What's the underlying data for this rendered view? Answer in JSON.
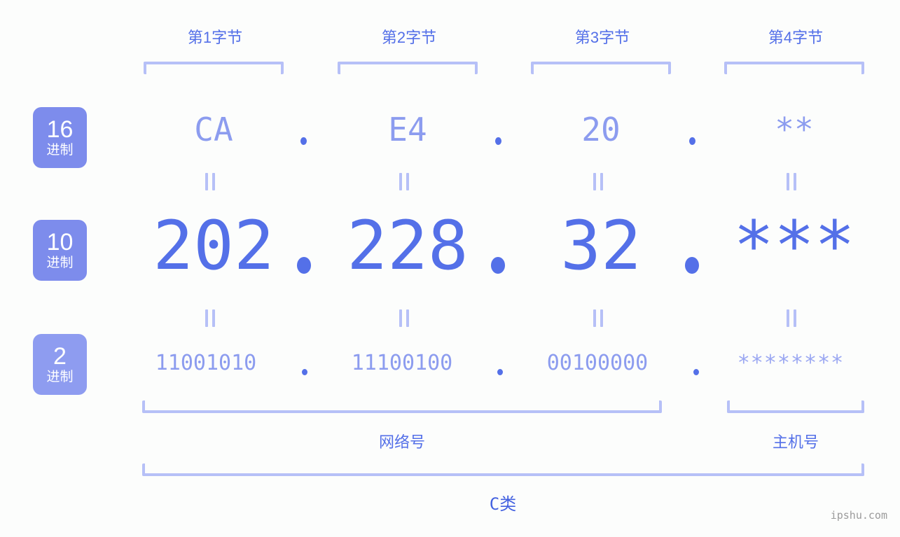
{
  "background_color": "#fcfdfc",
  "palette": {
    "accent_strong": "#5470e8",
    "accent_light": "#8c9cef",
    "bracket": "#b6c0f7",
    "badge": "#7d8cec",
    "badge_light": "#8e9cf0",
    "class_text": "#4361e0",
    "watermark": "#9b9b9b"
  },
  "byte_headers": [
    {
      "label": "第1字节"
    },
    {
      "label": "第2字节"
    },
    {
      "label": "第3字节"
    },
    {
      "label": "第4字节"
    }
  ],
  "rows": [
    {
      "badge_number": "16",
      "badge_sub": "进制",
      "values": [
        "CA",
        "E4",
        "20",
        "**"
      ],
      "separator": "."
    },
    {
      "badge_number": "10",
      "badge_sub": "进制",
      "values": [
        "202",
        "228",
        "32",
        "***"
      ],
      "separator": "."
    },
    {
      "badge_number": "2",
      "badge_sub": "进制",
      "values": [
        "11001010",
        "11100100",
        "00100000",
        "********"
      ],
      "separator": "."
    }
  ],
  "equals_marks": {
    "glyph": "||",
    "count_per_gap": 4,
    "gaps": 2
  },
  "sections": [
    {
      "label": "网络号"
    },
    {
      "label": "主机号"
    }
  ],
  "ip_class": {
    "label": "C类"
  },
  "watermark": {
    "text": "ipshu.com"
  }
}
